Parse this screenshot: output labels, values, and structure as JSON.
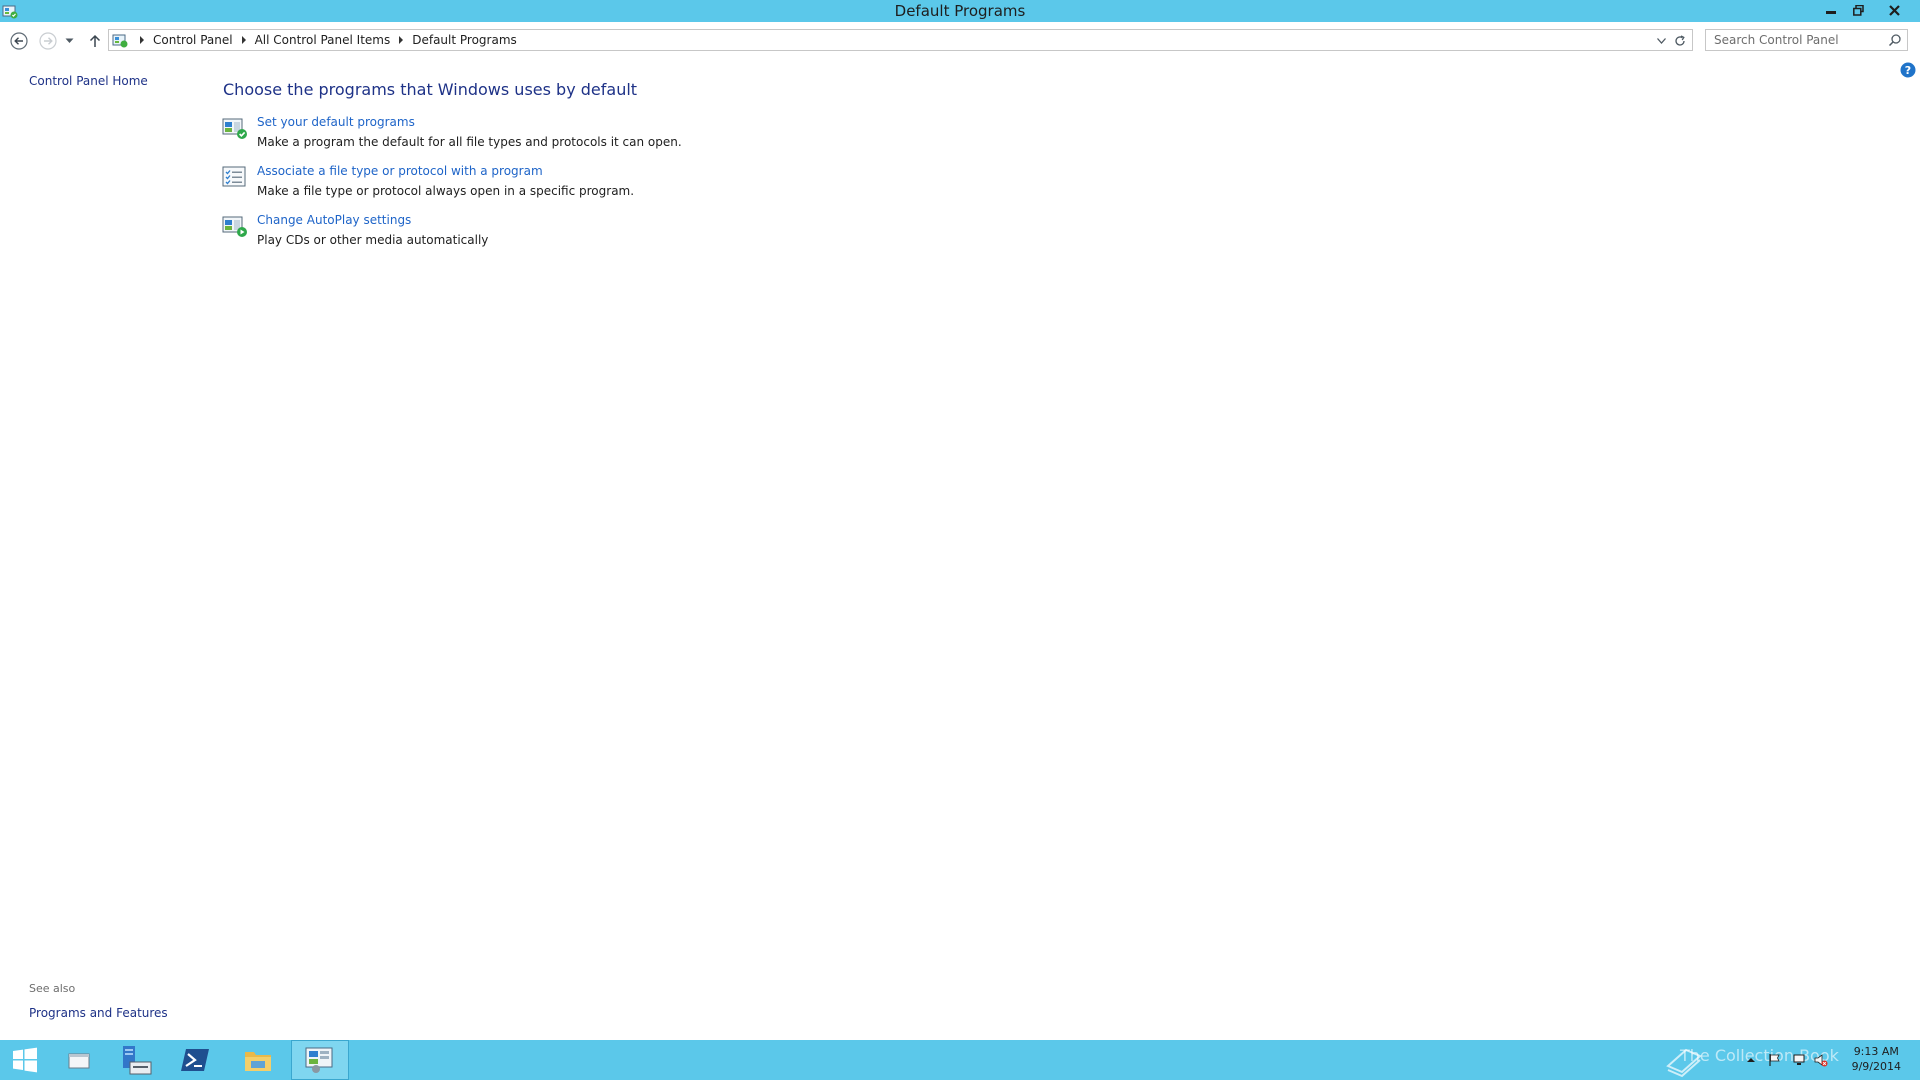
{
  "window": {
    "title": "Default Programs"
  },
  "address_bar": {
    "breadcrumbs": [
      "Control Panel",
      "All Control Panel Items",
      "Default Programs"
    ]
  },
  "search": {
    "placeholder": "Search Control Panel"
  },
  "left_pane": {
    "home_link": "Control Panel Home",
    "see_also_label": "See also",
    "see_also_links": [
      "Programs and Features"
    ]
  },
  "main": {
    "title": "Choose the programs that Windows uses by default",
    "tasks": [
      {
        "link": "Set your default programs",
        "description": "Make a program the default for all file types and protocols it can open.",
        "icon": "default-programs-icon"
      },
      {
        "link": "Associate a file type or protocol with a program",
        "description": "Make a file type or protocol always open in a specific program.",
        "icon": "file-association-icon"
      },
      {
        "link": "Change AutoPlay settings",
        "description": "Play CDs or other media automatically",
        "icon": "autoplay-icon"
      }
    ]
  },
  "taskbar": {
    "watermark": "The Collection Book",
    "clock_time": "9:13 AM",
    "clock_date": "9/9/2014"
  },
  "colors": {
    "titlebar": "#5bc8ea",
    "taskbar": "#5bc8ea",
    "link": "#1e64c8",
    "heading": "#1e3287"
  }
}
